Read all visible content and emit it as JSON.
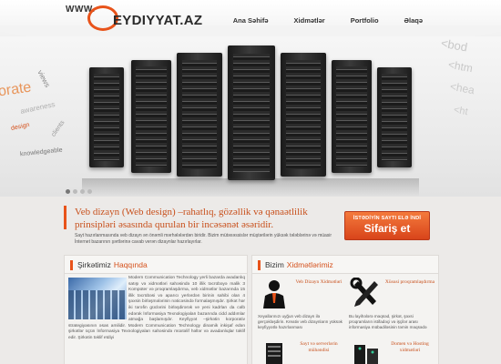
{
  "header": {
    "logo_prefix": "WWW.",
    "logo_name": "EYDIYYAT.AZ",
    "nav": [
      {
        "label": "Ana Səhifə"
      },
      {
        "label": "Xidmətlər"
      },
      {
        "label": "Portfolio"
      },
      {
        "label": "Əlaqə"
      }
    ]
  },
  "hero": {
    "words_left": [
      "orate",
      "views",
      "awareness",
      "design",
      "clients",
      "knowledgeable"
    ],
    "words_right": [
      "<bod",
      "<htm",
      "<hea",
      "<ht"
    ]
  },
  "intro": {
    "title": "Veb dizayn (Web design) –rahatlıq, gözəllik və qənaətlilik prinsipləri əsasında qurulan bir incəsənət əsəridir.",
    "subtitle": "Sayt hazırlanmasında veb dizayn ən önəmli mərhələlərdən biridir. Bizim mütəxəssislər müştərilərin yüksək tələblərinə və müasir İnternet bazarının şərtlərinə cavab verən dizaynlar hazırlayırlar.",
    "order_small": "İSTƏDİYİN SAYTI ELƏ İNDİ",
    "order_big": "Sifariş et"
  },
  "about": {
    "heading_1": "Şirkətimiz",
    "heading_2": "Haqqında",
    "text": "Modern Communication Technology yerli bazarda avadanlıq satışı və xidmətləri sahəsində 10 illik təcrübəyə malik 3 Kompüter və proqramlaşdırma, veb xidmətlər bazarında 15 illik təcrübəsi və aparıcı yerlərdən birinin sahibi olan 4 şəxsin birləşmələrinin nəticəsində formalaşmışdır. Şirkət hər iki tərəfin güclərini birləşdirərək ve yeni kadrları da cəlb edərək İnformasiya Texnologiyaları bazarında cidd addımlar atmağa başlamışdır. Keyfiyyət –şirkətin korporativ strategiyasının əsas amilidir. Modern Communication Technology dinamik inkişaf edən şirkətlər üçün İnformasiya Texnologiyaları sahəsində müxtəlif həllər və avadanlıqlar təklif edir. Şirkətin təklif etdiyi"
  },
  "services": {
    "heading_1": "Bizim",
    "heading_2": "Xidmətlərimiz",
    "items": [
      {
        "title": "Veb Dizayn Xidmətləri",
        "desc": "Xeyallarınızı uyğun veb dizayn ilə gerçəkləşdirin. Kreativ veb dizaynların yüksək keyfiyyətlə hazırlanması"
      },
      {
        "title": "Xüsusi proqramlaşdırma",
        "desc": "Bu layihələrə məqsəd, şirkət, şəxsi proqramların istifadəçi və işçilər arası informasiya mübadiləsinin təmin məqsədə"
      },
      {
        "title": "Sayt və serverlərin mühəndisi",
        "desc": ""
      },
      {
        "title": "Domen və Hosting xidmətləri",
        "desc": ""
      }
    ]
  }
}
